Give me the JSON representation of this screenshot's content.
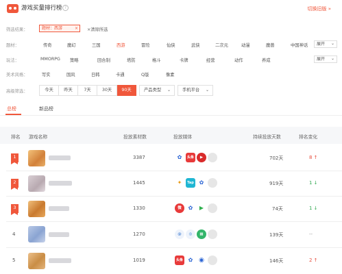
{
  "header": {
    "title": "游戏买量排行榜",
    "help": "?",
    "switch_label": "切换旧版 »"
  },
  "filters": {
    "result_label": "筛选结果：",
    "selected_tag": "题材：西游",
    "selected_tag_close": "×",
    "clear_label": "×清除所选",
    "theme": {
      "label": "题材：",
      "options": [
        "传奇",
        "魔幻",
        "三国",
        "西游",
        "冒险",
        "仙侠",
        "武侠",
        "二次元",
        "动漫",
        "魔兽",
        "中国神话"
      ],
      "active": "西游",
      "more": "展开"
    },
    "gameplay": {
      "label": "玩法：",
      "options": [
        "MMORPG",
        "策略",
        "回合制",
        "塔防",
        "格斗",
        "卡牌",
        "经营",
        "动作",
        "养成"
      ],
      "more": "展开"
    },
    "style": {
      "label": "美术风格：",
      "options": [
        "写实",
        "国风",
        "日韩",
        "卡通",
        "Q版",
        "像素"
      ]
    },
    "advanced": {
      "label": "高级筛选：",
      "days": [
        "今天",
        "昨天",
        "7天",
        "30天",
        "90天"
      ],
      "active_day": "90天",
      "product_type": "产品类型",
      "platform": "手机平台"
    }
  },
  "tabs": [
    {
      "label": "总榜",
      "active": true
    },
    {
      "label": "新品榜",
      "active": false
    }
  ],
  "table": {
    "columns": [
      "排名",
      "游戏名称",
      "投放素材数",
      "投放媒体",
      "持续投放天数",
      "排名变化"
    ],
    "rows": [
      {
        "rank": "1",
        "materials": "3387",
        "days": "702天",
        "change": "8 ↑",
        "change_dir": "up",
        "thumb_color": "#e0a24a",
        "media": [
          {
            "icon": "baidu-icon",
            "text": "🐾",
            "bg": "#ffffff",
            "fg": "#2a64d4"
          },
          {
            "icon": "toutiao-icon",
            "text": "头条",
            "bg": "#e83a3a"
          },
          {
            "icon": "video-icon",
            "text": "▶",
            "bg": "#d92b2b"
          },
          {
            "icon": "more-icon",
            "text": "",
            "bg": "#e6e6e6"
          }
        ]
      },
      {
        "rank": "2",
        "materials": "1445",
        "days": "919天",
        "change": "1 ↓",
        "change_dir": "down",
        "thumb_color": "#cfc3c8",
        "media": [
          {
            "icon": "uc-icon",
            "text": "U",
            "bg": "#ffffff",
            "fg": "#e89a14"
          },
          {
            "icon": "taptap-icon",
            "text": "Tap",
            "bg": "#1fb6d3"
          },
          {
            "icon": "baidu-icon",
            "text": "🐾",
            "bg": "#ffffff",
            "fg": "#2a64d4"
          },
          {
            "icon": "more-icon",
            "text": "",
            "bg": "#e6e6e6"
          }
        ]
      },
      {
        "rank": "3",
        "materials": "1330",
        "days": "74天",
        "change": "1 ↓",
        "change_dir": "down",
        "thumb_color": "#d9933c",
        "media": [
          {
            "icon": "sina-icon",
            "text": "微",
            "bg": "#e83a3a"
          },
          {
            "icon": "baidu-icon",
            "text": "🐾",
            "bg": "#ffffff",
            "fg": "#2a64d4"
          },
          {
            "icon": "play-store-icon",
            "text": "▶",
            "bg": "#ffffff",
            "fg": "#30b04f"
          },
          {
            "icon": "more-icon",
            "text": "",
            "bg": "#e6e6e6"
          }
        ]
      },
      {
        "rank": "4",
        "materials": "1270",
        "days": "139天",
        "change": "--",
        "change_dir": "same",
        "thumb_color": "#9db3d8",
        "media": [
          {
            "icon": "qq-icon",
            "text": "@",
            "bg": "#eef3fb",
            "fg": "#5a8fd8"
          },
          {
            "icon": "circle-icon",
            "text": "◎",
            "bg": "#eef3fb",
            "fg": "#3b83d6"
          },
          {
            "icon": "store-icon",
            "text": "▦",
            "bg": "#33b56a"
          },
          {
            "icon": "more-icon",
            "text": "",
            "bg": "#e6e6e6"
          }
        ]
      },
      {
        "rank": "5",
        "materials": "1019",
        "days": "146天",
        "change": "2 ↑",
        "change_dir": "up",
        "thumb_color": "#d8a35a",
        "media": [
          {
            "icon": "toutiao-icon",
            "text": "头条",
            "bg": "#e83a3a"
          },
          {
            "icon": "baidu-icon",
            "text": "🐾",
            "bg": "#ffffff",
            "fg": "#2a64d4"
          },
          {
            "icon": "circle-icon",
            "text": "◉",
            "bg": "#ffffff",
            "fg": "#2a64d4"
          },
          {
            "icon": "more-icon",
            "text": "",
            "bg": "#e6e6e6"
          }
        ]
      }
    ]
  },
  "colors": {
    "accent": "#f0573b",
    "up": "#e74c3c",
    "down": "#2fa84f"
  }
}
